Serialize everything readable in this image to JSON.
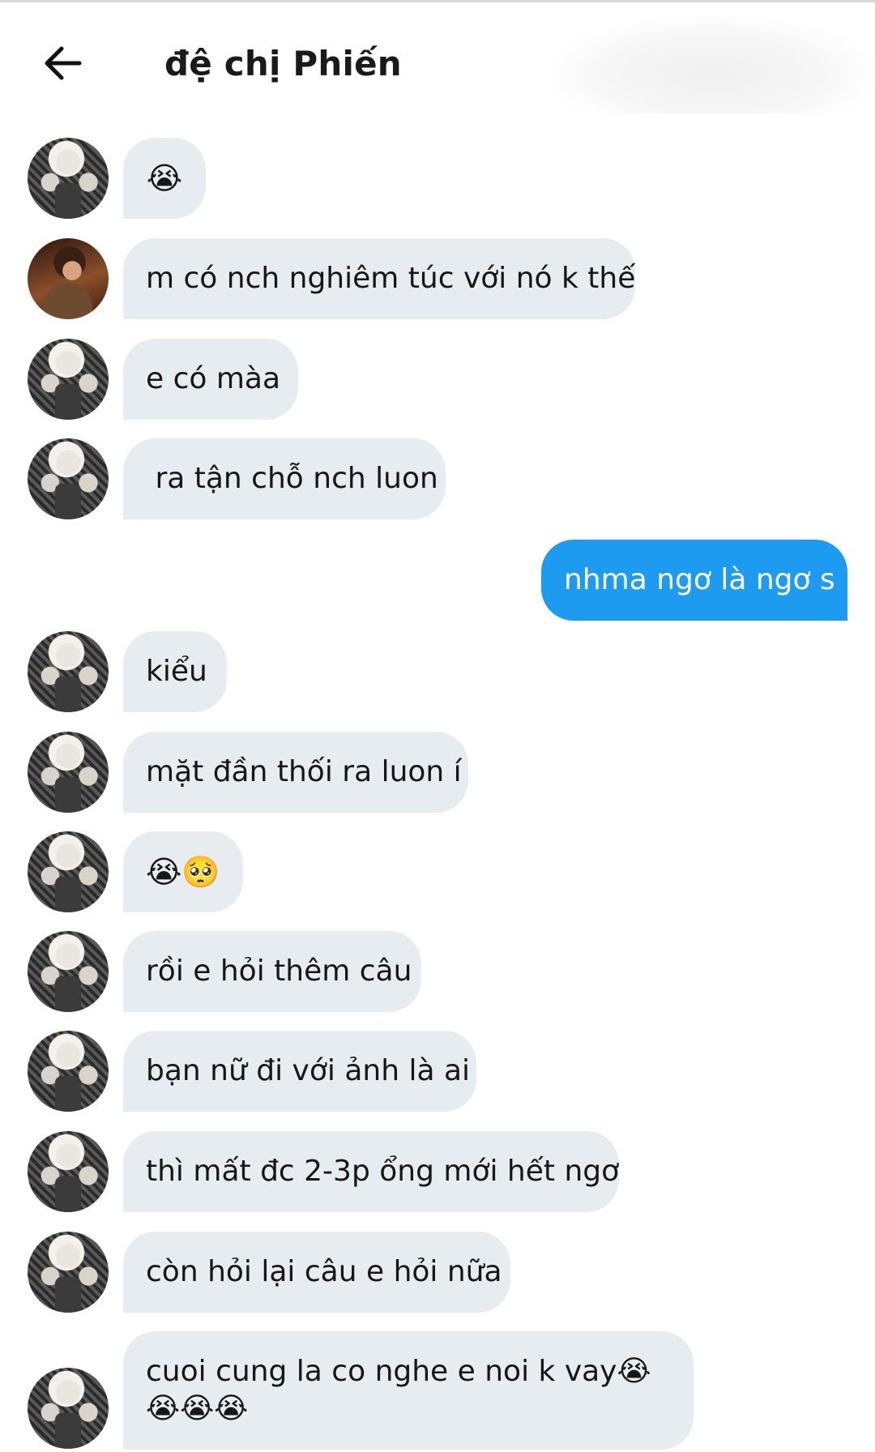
{
  "header": {
    "title": "đệ chị Phiến",
    "back_icon": "arrow-left-icon"
  },
  "colors": {
    "received_bubble": "#e7ecf0",
    "sent_bubble": "#1d9bf0",
    "sent_text": "#ffffff"
  },
  "messages": [
    {
      "side": "received",
      "avatar": "blonde",
      "text": "😭"
    },
    {
      "side": "received",
      "avatar": "dark",
      "text": "m có nch nghiêm túc với nó k thế"
    },
    {
      "side": "received",
      "avatar": "blonde",
      "text": "e có màa"
    },
    {
      "side": "received",
      "avatar": "blonde",
      "text": " ra tận chỗ nch luon"
    },
    {
      "side": "sent",
      "text": "nhma ngơ là ngơ s"
    },
    {
      "side": "received",
      "avatar": "blonde",
      "text": "kiểu"
    },
    {
      "side": "received",
      "avatar": "blonde",
      "text": "mặt đần thối ra luon í"
    },
    {
      "side": "received",
      "avatar": "blonde",
      "text": "😭🥺"
    },
    {
      "side": "received",
      "avatar": "blonde",
      "text": "rồi e hỏi thêm câu"
    },
    {
      "side": "received",
      "avatar": "blonde",
      "text": "bạn nữ đi với ảnh là ai"
    },
    {
      "side": "received",
      "avatar": "blonde",
      "text": "thì mất đc 2-3p ổng mới hết ngơ"
    },
    {
      "side": "received",
      "avatar": "blonde",
      "text": "còn hỏi lại câu e hỏi nữa"
    },
    {
      "side": "received",
      "avatar": "blonde",
      "text": "cuoi cung la co nghe e noi k vay😭😭😭😭"
    }
  ]
}
